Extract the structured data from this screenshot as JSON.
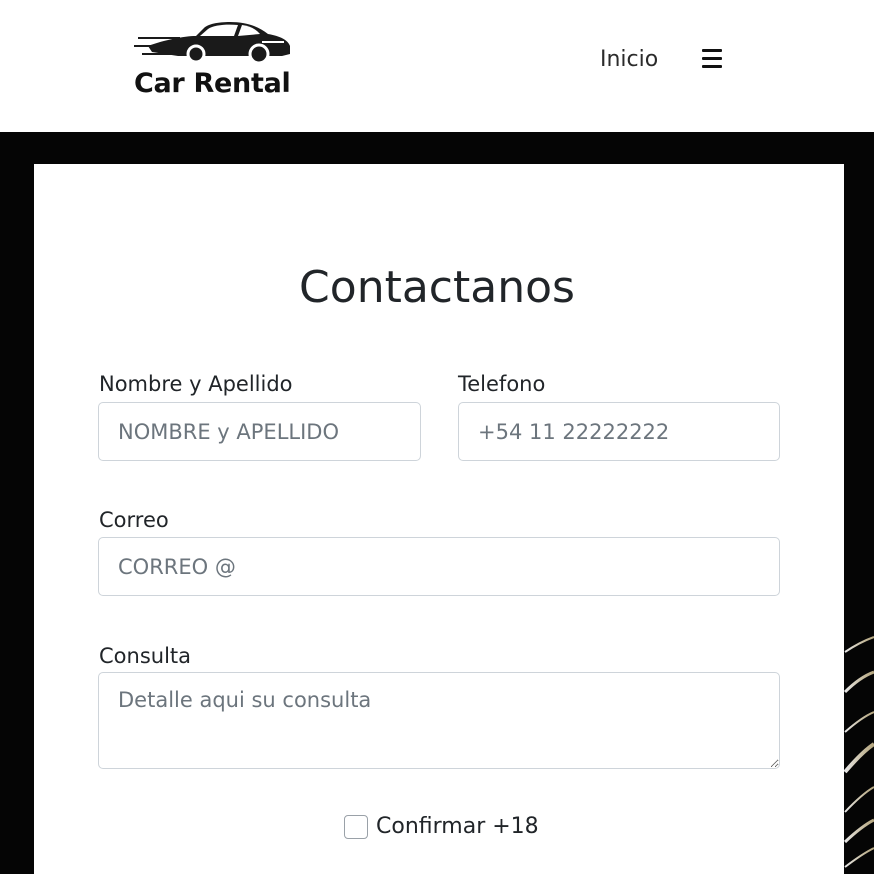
{
  "brand": {
    "name": "Car Rental",
    "logo_icon": "car-icon"
  },
  "nav": {
    "link_inicio": "Inicio",
    "menu_icon": "hamburger-icon"
  },
  "form": {
    "title": "Contactanos",
    "name": {
      "label": "Nombre y Apellido",
      "placeholder": "NOMBRE y APELLIDO",
      "value": ""
    },
    "phone": {
      "label": "Telefono",
      "placeholder": "+54 11 22222222",
      "value": ""
    },
    "email": {
      "label": "Correo",
      "placeholder": "CORREO @",
      "value": ""
    },
    "query": {
      "label": "Consulta",
      "placeholder": "Detalle aqui su consulta",
      "value": ""
    },
    "confirm": {
      "label": "Confirmar +18",
      "checked": false
    }
  },
  "colors": {
    "navbar_bg": "#ffffff",
    "hero_bg": "#050505",
    "card_bg": "#ffffff",
    "input_border": "#ced4da",
    "placeholder": "#6c757d"
  }
}
